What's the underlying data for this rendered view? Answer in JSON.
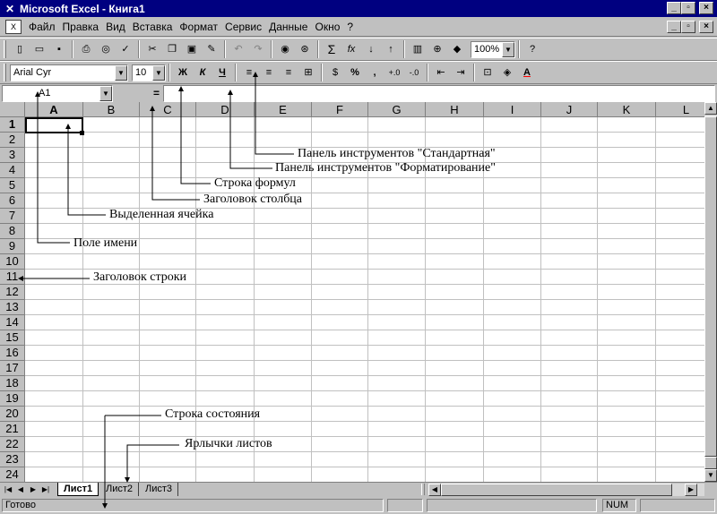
{
  "window": {
    "title": "Microsoft Excel - Книга1"
  },
  "menu": [
    "Файл",
    "Правка",
    "Вид",
    "Вставка",
    "Формат",
    "Сервис",
    "Данные",
    "Окно",
    "?"
  ],
  "standard_toolbar": {
    "zoom": "100%"
  },
  "formatting_toolbar": {
    "font": "Arial Cyr",
    "size": "10",
    "bold": "Ж",
    "italic": "К",
    "underline": "Ч",
    "currency": "$",
    "percent": "%",
    "comma": ","
  },
  "formula_bar": {
    "name_box": "A1",
    "equals": "="
  },
  "columns": [
    "A",
    "B",
    "C",
    "D",
    "E",
    "F",
    "G",
    "H",
    "I",
    "J",
    "K",
    "L"
  ],
  "rows": [
    "1",
    "2",
    "3",
    "4",
    "5",
    "6",
    "7",
    "8",
    "9",
    "10",
    "11",
    "12",
    "13",
    "14",
    "15",
    "16",
    "17",
    "18",
    "19",
    "20",
    "21",
    "22",
    "23",
    "24"
  ],
  "sheets": [
    "Лист1",
    "Лист2",
    "Лист3"
  ],
  "status": {
    "text": "Готово",
    "num": "NUM"
  },
  "annotations": {
    "standard_toolbar": "Панель инструментов \"Стандартная\"",
    "formatting_toolbar": "Панель инструментов \"Форматирование\"",
    "formula_bar": "Строка формул",
    "column_header": "Заголовок столбца",
    "selected_cell": "Выделенная ячейка",
    "name_box": "Поле имени",
    "row_header": "Заголовок строки",
    "status_bar": "Строка состояния",
    "sheet_tabs": "Ярлычки листов"
  }
}
